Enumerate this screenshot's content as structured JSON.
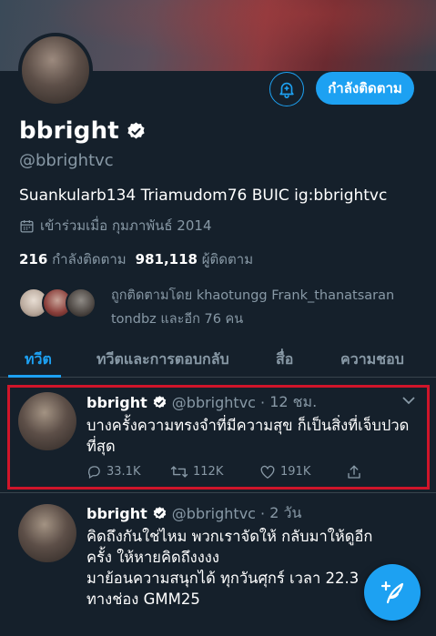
{
  "profile": {
    "display_name": "bbright",
    "handle": "@bbrightvc",
    "bio": "Suankularb134 Triamudom76 BUIC ig:bbrightvc",
    "joined": "เข้าร่วมเมื่อ กุมภาพันธ์ 2014",
    "following_count": "216",
    "following_label": "กำลังติดตาม",
    "followers_count": "981,118",
    "followers_label": "ผู้ติดตาม",
    "followed_by_text": "ถูกติดตามโดย khaotungg Frank_thanatsaran tondbz และอีก 76 คน"
  },
  "buttons": {
    "follow_label": "กำลังติดตาม",
    "bell_icon": "bell-plus-icon"
  },
  "tabs": [
    {
      "label": "ทวีต",
      "active": true
    },
    {
      "label": "ทวีตและการตอบกลับ",
      "active": false
    },
    {
      "label": "สื่อ",
      "active": false
    },
    {
      "label": "ความชอบ",
      "active": false
    }
  ],
  "tweets": [
    {
      "name": "bbright",
      "handle": "@bbrightvc",
      "time": "12 ชม.",
      "text": "บางครั้งความทรงจำที่มีความสุข ก็เป็นสิ่งที่เจ็บปวดที่สุด",
      "replies": "33.1K",
      "retweets": "112K",
      "likes": "191K",
      "highlighted": true
    },
    {
      "name": "bbright",
      "handle": "@bbrightvc",
      "time": "2 วัน",
      "text_lines": [
        "คิดถึงกันใช่ไหม พวกเราจัดให้ กลับมาให้ดูอีก",
        "ครั้ง ให้หายคิดถึงงงง",
        "มาย้อนความสนุกได้ ทุกวันศุกร์ เวลา 22.3",
        "ทางช่อง GMM25"
      ]
    }
  ],
  "colors": {
    "background": "#15202b",
    "accent": "#1da1f2",
    "secondary_text": "#8899a6",
    "highlight": "#d0152a"
  }
}
